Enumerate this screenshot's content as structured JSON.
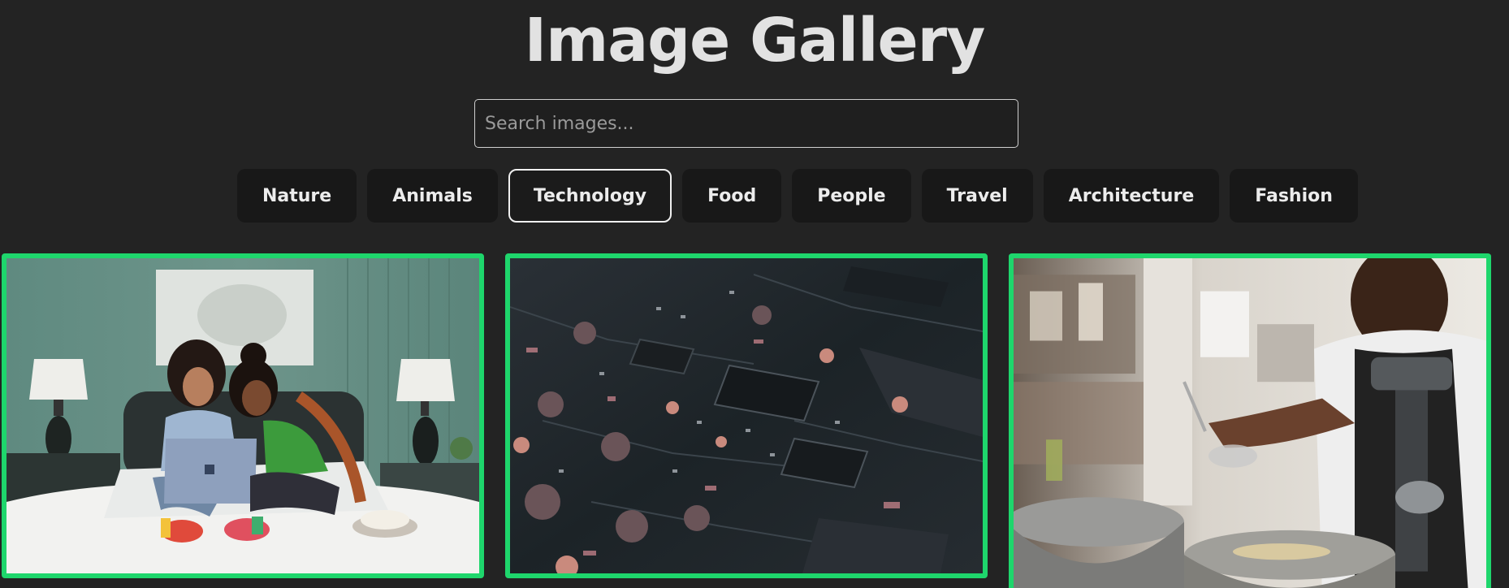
{
  "header": {
    "title": "Image Gallery"
  },
  "search": {
    "placeholder": "Search images..."
  },
  "categories": [
    {
      "label": "Nature",
      "active": false
    },
    {
      "label": "Animals",
      "active": false
    },
    {
      "label": "Technology",
      "active": true
    },
    {
      "label": "Food",
      "active": false
    },
    {
      "label": "People",
      "active": false
    },
    {
      "label": "Travel",
      "active": false
    },
    {
      "label": "Architecture",
      "active": false
    },
    {
      "label": "Fashion",
      "active": false
    }
  ],
  "gallery": {
    "highlight_color": "#1ed66c",
    "images": [
      {
        "subject": "two women on bed with laptop"
      },
      {
        "subject": "circuit board close-up"
      },
      {
        "subject": "man whisking in kitchen"
      }
    ]
  },
  "colors": {
    "background": "#232323",
    "accent": "#1ed66c",
    "button_bg": "#181818"
  }
}
